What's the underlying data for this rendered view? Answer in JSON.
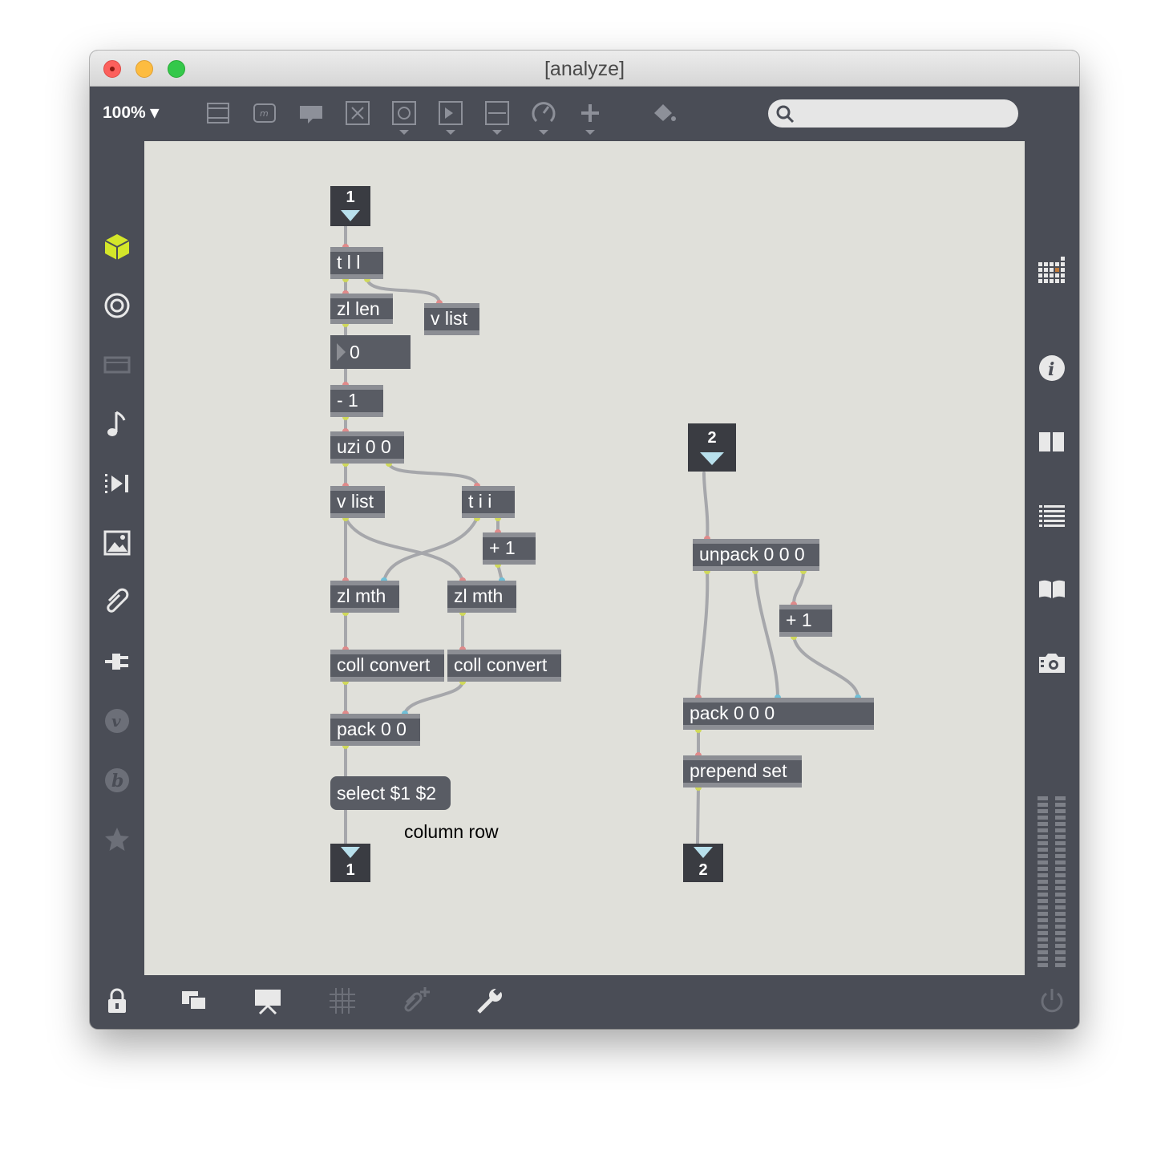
{
  "window": {
    "title": "[analyze]"
  },
  "toolbar": {
    "zoom": "100% ▾",
    "tools": [
      "object-icon",
      "message-icon",
      "comment-icon",
      "button-icon",
      "toggle-icon",
      "number-icon",
      "slider-icon",
      "dial-icon",
      "plus-icon",
      "paint-bucket-icon"
    ],
    "search_placeholder": ""
  },
  "left_sidebar": [
    "cube-icon",
    "target-icon",
    "window-icon",
    "note-icon",
    "sequence-icon",
    "image-icon",
    "paperclip-icon",
    "plug-icon",
    "v-icon",
    "b-icon",
    "star-icon"
  ],
  "right_sidebar": [
    "grid-icon",
    "info-icon",
    "columns-icon",
    "list-icon",
    "book-icon",
    "camera-icon"
  ],
  "bottom_bar": [
    "lock-icon",
    "windows-icon",
    "presentation-icon",
    "grid-icon",
    "paperclip-add-icon",
    "wrench-icon",
    "power-icon"
  ],
  "patch": {
    "inlet_1": "1",
    "t_ll": "t l l",
    "zl_len": "zl len",
    "v_list_a": "v list",
    "number_box": "0",
    "minus_one": "- 1",
    "uzi": "uzi 0 0",
    "v_list_b": "v list",
    "t_ii": "t i i",
    "plus_one_a": "+ 1",
    "zl_mth_a": "zl mth",
    "zl_mth_b": "zl mth",
    "coll_convert_a": "coll convert",
    "coll_convert_b": "coll convert",
    "pack_00": "pack 0 0",
    "select_msg": "select $1 $2",
    "comment": "column row",
    "outlet_1": "1",
    "inlet_2": "2",
    "unpack": "unpack 0 0 0",
    "plus_one_b": "+ 1",
    "pack_000": "pack 0 0 0",
    "prepend": "prepend set",
    "outlet_2": "2"
  },
  "colors": {
    "accent_cube": "#d4e62a",
    "object_bg": "#595c64",
    "canvas_bg": "#e0e0da",
    "chrome_bg": "#4a4d56"
  }
}
